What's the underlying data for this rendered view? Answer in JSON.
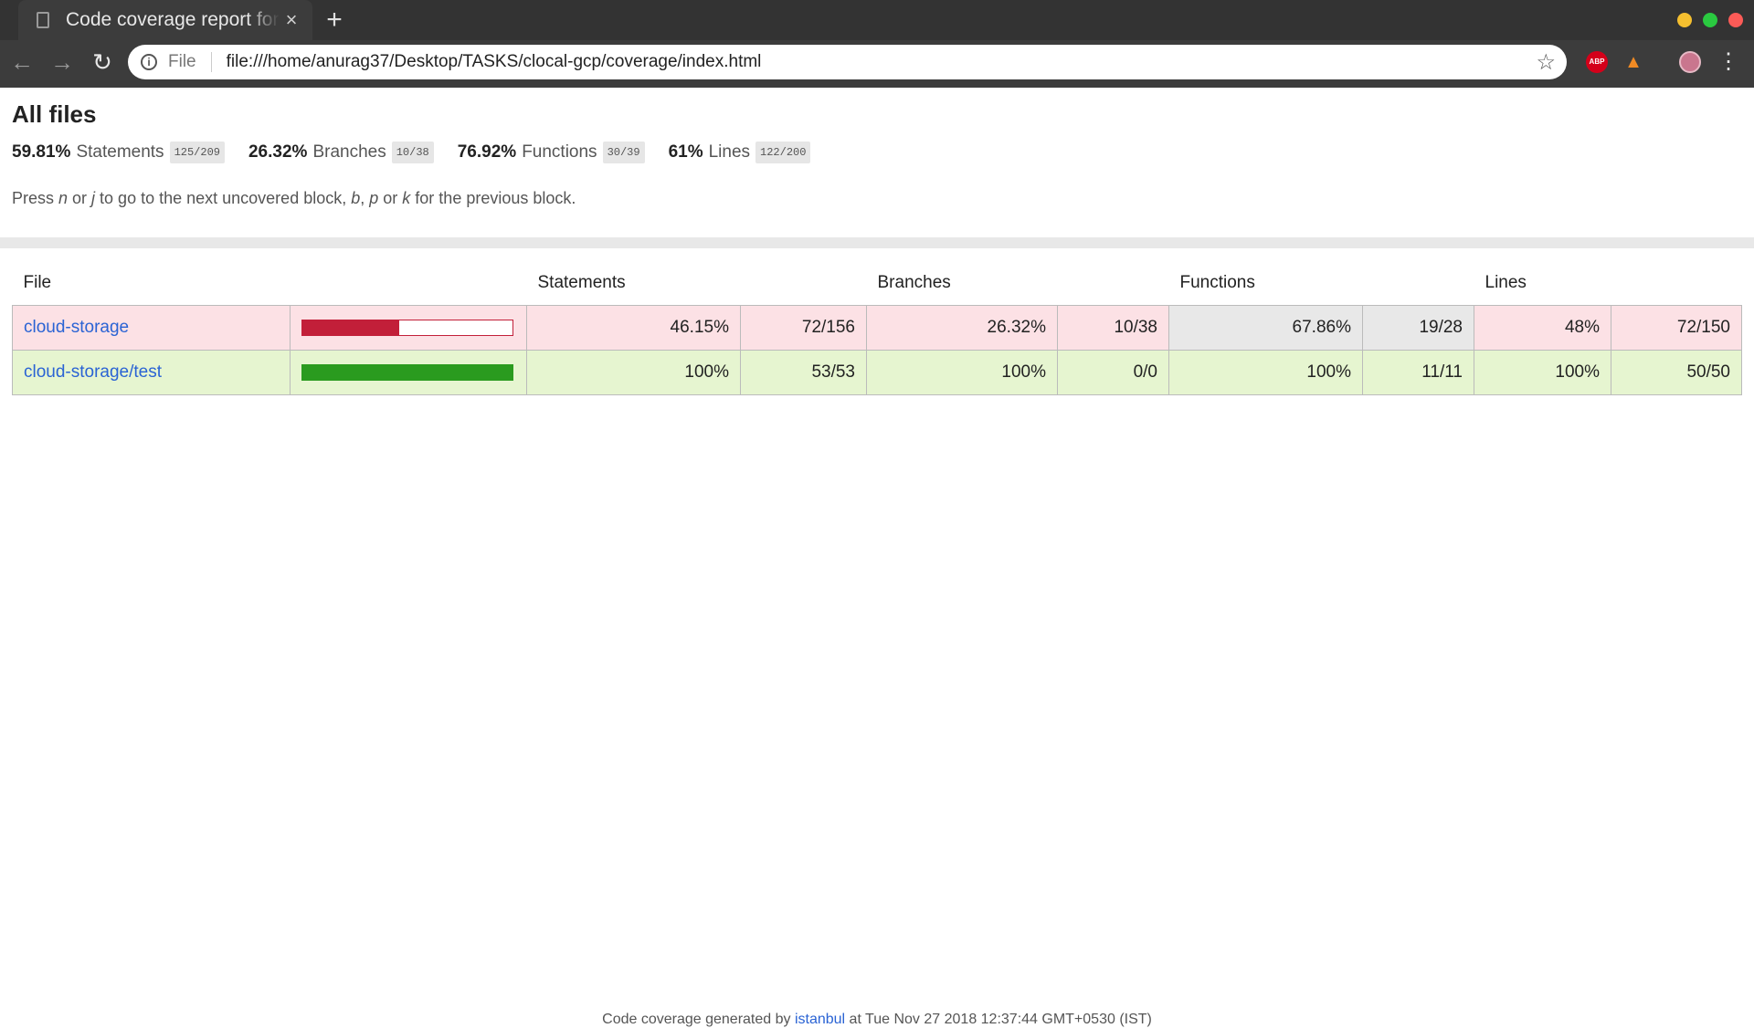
{
  "browser": {
    "tab_title": "Code coverage report for All files",
    "tab_close": "×",
    "new_tab": "+",
    "url_scheme": "File",
    "url": "file:///home/anurag37/Desktop/TASKS/clocal-gcp/coverage/index.html",
    "extensions": {
      "abp_label": "ABP"
    },
    "window_buttons": {
      "minimize": "#f5bf2f",
      "maximize": "#2ac940",
      "close": "#fc5b57"
    }
  },
  "report": {
    "title": "All files",
    "summary": [
      {
        "pct": "59.81%",
        "label": "Statements",
        "fraction": "125/209"
      },
      {
        "pct": "26.32%",
        "label": "Branches",
        "fraction": "10/38"
      },
      {
        "pct": "76.92%",
        "label": "Functions",
        "fraction": "30/39"
      },
      {
        "pct": "61%",
        "label": "Lines",
        "fraction": "122/200"
      }
    ],
    "hint": {
      "prefix": "Press ",
      "k1": "n",
      "or1": " or ",
      "k2": "j",
      "mid": " to go to the next uncovered block, ",
      "k3": "b",
      "comma": ", ",
      "k4": "p",
      "or2": " or ",
      "k5": "k",
      "suffix": " for the previous block."
    },
    "table": {
      "headers": {
        "file": "File",
        "statements": "Statements",
        "branches": "Branches",
        "functions": "Functions",
        "lines": "Lines"
      },
      "rows": [
        {
          "file": "cloud-storage",
          "coverage": 0.4615,
          "bar_color": "#c21f39",
          "statements_pct": "46.15%",
          "statements_frac": "72/156",
          "branches_pct": "26.32%",
          "branches_frac": "10/38",
          "functions_pct": "67.86%",
          "functions_frac": "19/28",
          "lines_pct": "48%",
          "lines_frac": "72/150"
        },
        {
          "file": "cloud-storage/test",
          "coverage": 1.0,
          "bar_color": "#2a9b1f",
          "statements_pct": "100%",
          "statements_frac": "53/53",
          "branches_pct": "100%",
          "branches_frac": "0/0",
          "functions_pct": "100%",
          "functions_frac": "11/11",
          "lines_pct": "100%",
          "lines_frac": "50/50"
        }
      ]
    },
    "footer": {
      "prefix": "Code coverage generated by ",
      "link": "istanbul",
      "suffix": " at Tue Nov 27 2018 12:37:44 GMT+0530 (IST)"
    }
  }
}
